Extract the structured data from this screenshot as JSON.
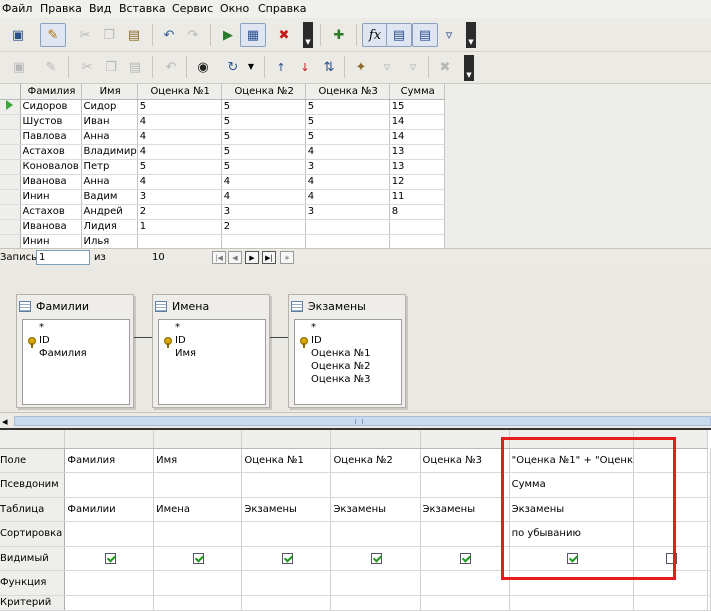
{
  "menu": [
    "Файл",
    "Правка",
    "Вид",
    "Вставка",
    "Сервис",
    "Окно",
    "Справка"
  ],
  "toolbar1_icons": [
    "save-icon",
    "edit-icon",
    "cut-icon",
    "copy-icon",
    "paste-icon",
    "undo-icon",
    "redo-icon",
    "run-query-icon",
    "clear-query-icon",
    "delete-icon",
    "dropdown-icon",
    "add-table-icon",
    "function-icon",
    "design-view-icon",
    "sql-view-icon",
    "limit-icon",
    "filter-icon",
    "dropdown-icon"
  ],
  "toolbar2_icons": [
    "save-record-icon",
    "edit-data-icon",
    "cut-icon",
    "copy-icon",
    "paste-icon",
    "undo-icon",
    "find-record-icon",
    "refresh-icon",
    "dropdown-icon",
    "sort-ascending-icon",
    "sort-descending-icon",
    "sort-icon",
    "autofilter-icon",
    "standard-filter-icon",
    "apply-filter-icon",
    "remove-filter-icon",
    "dropdown-icon"
  ],
  "results": {
    "columns": [
      "Фамилия",
      "Имя",
      "Оценка №1",
      "Оценка №2",
      "Оценка №3",
      "Сумма"
    ],
    "rows": [
      [
        "Сидоров",
        "Сидор",
        "5",
        "5",
        "5",
        "15"
      ],
      [
        "Шустов",
        "Иван",
        "4",
        "5",
        "5",
        "14"
      ],
      [
        "Павлова",
        "Анна",
        "4",
        "5",
        "5",
        "14"
      ],
      [
        "Астахов",
        "Владимир",
        "4",
        "5",
        "4",
        "13"
      ],
      [
        "Коновалов",
        "Петр",
        "5",
        "5",
        "3",
        "13"
      ],
      [
        "Иванова",
        "Анна",
        "4",
        "4",
        "4",
        "12"
      ],
      [
        "Инин",
        "Вадим",
        "3",
        "4",
        "4",
        "11"
      ],
      [
        "Астахов",
        "Андрей",
        "2",
        "3",
        "3",
        "8"
      ],
      [
        "Иванова",
        "Лидия",
        "1",
        "2",
        "",
        ""
      ],
      [
        "Инин",
        "Илья",
        "",
        "",
        "",
        ""
      ]
    ]
  },
  "record_nav": {
    "label": "Запись",
    "current": "1",
    "of_label": "из",
    "total": "10"
  },
  "tables": [
    {
      "title": "Фамилии",
      "fields": [
        "*",
        "ID",
        "Фамилия"
      ]
    },
    {
      "title": "Имена",
      "fields": [
        "*",
        "ID",
        "Имя"
      ]
    },
    {
      "title": "Экзамены",
      "fields": [
        "*",
        "ID",
        "Оценка №1",
        "Оценка №2",
        "Оценка №3"
      ]
    }
  ],
  "design": {
    "row_labels": [
      "Поле",
      "Псевдоним",
      "Таблица",
      "Сортировка",
      "Видимый",
      "Функция",
      "Критерий"
    ],
    "columns": [
      {
        "field": "Фамилия",
        "alias": "",
        "table": "Фамилии",
        "sort": "",
        "visible": true
      },
      {
        "field": "Имя",
        "alias": "",
        "table": "Имена",
        "sort": "",
        "visible": true
      },
      {
        "field": "Оценка №1",
        "alias": "",
        "table": "Экзамены",
        "sort": "",
        "visible": true
      },
      {
        "field": "Оценка №2",
        "alias": "",
        "table": "Экзамены",
        "sort": "",
        "visible": true
      },
      {
        "field": "Оценка №3",
        "alias": "",
        "table": "Экзамены",
        "sort": "",
        "visible": true
      },
      {
        "field": "\"Оценка №1\" + \"Оценк",
        "alias": "Сумма",
        "table": "Экзамены",
        "sort": "по убыванию",
        "visible": true
      },
      {
        "field": "",
        "alias": "",
        "table": "",
        "sort": "",
        "visible": false
      }
    ]
  },
  "highlight_color": "#e81c1c"
}
